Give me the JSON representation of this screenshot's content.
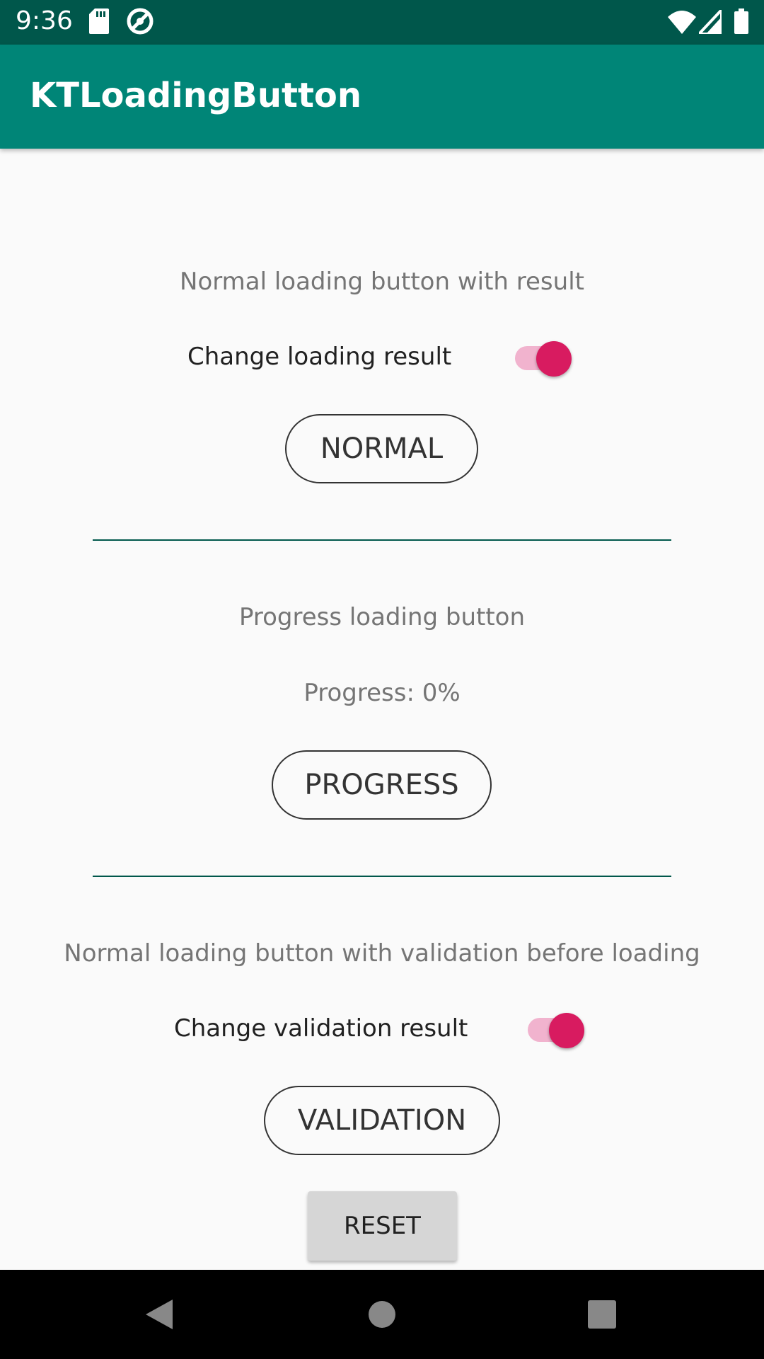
{
  "status_bar": {
    "time": "9:36",
    "icons": [
      "sd-card-icon",
      "data-saver-icon",
      "wifi-icon",
      "signal-icon",
      "battery-icon"
    ]
  },
  "app_bar": {
    "title": "KTLoadingButton"
  },
  "section_normal": {
    "label": "Normal loading button with result",
    "switch_label": "Change loading result",
    "switch_on": true,
    "button_label": "NORMAL"
  },
  "section_progress": {
    "label": "Progress loading button",
    "progress_text": "Progress: 0%",
    "button_label": "PROGRESS"
  },
  "section_validation": {
    "label": "Normal loading button with validation before loading",
    "switch_label": "Change validation result",
    "switch_on": true,
    "button_label": "VALIDATION"
  },
  "reset_label": "RESET",
  "colors": {
    "status_bar": "#00574b",
    "app_bar": "#008577",
    "accent": "#d81b60",
    "divider": "#00574b"
  },
  "nav_bar": {
    "icons": [
      "back-icon",
      "home-icon",
      "recents-icon"
    ]
  }
}
